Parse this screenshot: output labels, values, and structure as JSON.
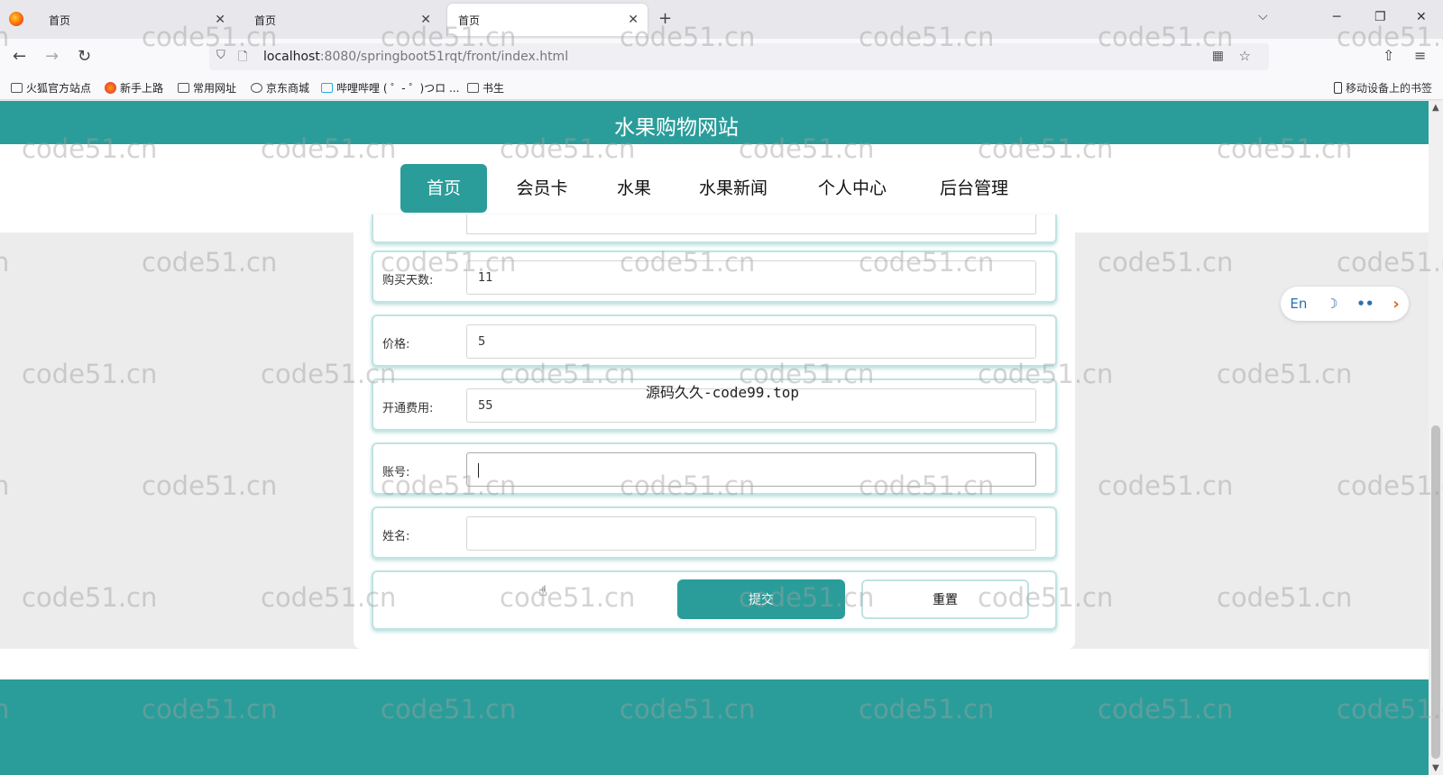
{
  "browser": {
    "tabs": [
      {
        "label": "首页",
        "active": false
      },
      {
        "label": "首页",
        "active": false
      },
      {
        "label": "首页",
        "active": true
      }
    ],
    "new_tab_label": "+",
    "url_host": "localhost",
    "url_path": ":8080/springboot51rqt/front/index.html",
    "bookmarks": [
      "火狐官方站点",
      "新手上路",
      "常用网址",
      "京东商城",
      "哔哩哔哩 ( ゜- ゜)つロ ...",
      "书生"
    ],
    "mobile_bookmarks": "移动设备上的书签"
  },
  "site": {
    "title": "水果购物网站",
    "menu": [
      "首页",
      "会员卡",
      "水果",
      "水果新闻",
      "个人中心",
      "后台管理"
    ],
    "active_menu": "首页",
    "brand_color": "#2a9d9a"
  },
  "form": {
    "fields": [
      {
        "label": "购买天数:",
        "value": "11"
      },
      {
        "label": "价格:",
        "value": "5"
      },
      {
        "label": "开通费用:",
        "value": "55"
      },
      {
        "label": "账号:",
        "value": ""
      },
      {
        "label": "姓名:",
        "value": ""
      }
    ],
    "submit_label": "提交",
    "reset_label": "重置"
  },
  "lang_widget": {
    "en": "En",
    "moon_icon": "☽",
    "quote_icon": "••",
    "arrow_icon": "›"
  },
  "overlay_text": "源码久久-code99.top",
  "watermark_text": "code51.cn"
}
